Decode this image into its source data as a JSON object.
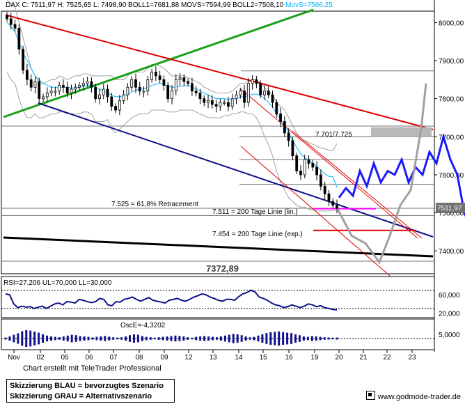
{
  "header": {
    "text": "DAX C: 7511,97 H: 7525,65 L: 7498,90 BOLL1=7681,88 MOVS=7594,99 BOLL2=7508,10",
    "movs_label": "MovS=7566,25"
  },
  "footer": {
    "credit": "Chart erstellt mit TeleTrader Professional",
    "legend_blue": "Skizzierung BLAU = bevorzugtes Szenario",
    "legend_gray": "Skizzierung GRAU = Alternativszenario",
    "site": "www.godmode-trader.de"
  },
  "colors": {
    "candle": "#000000",
    "bollinger": "#a0a0a0",
    "movs": "#00b4ff",
    "resistance": "#e00000",
    "support_green": "#18a018",
    "support_navy": "#10108a",
    "scenario_blue": "#1a1aff",
    "scenario_gray": "#a0a0a0",
    "ma_line": "#ff00ff",
    "indicator": "#10108a"
  },
  "chart_data": [
    {
      "type": "candlestick",
      "title": "DAX",
      "x_ticks": [
        "Nov",
        "02",
        "05",
        "06",
        "07",
        "08",
        "09",
        "12",
        "13",
        "14",
        "15",
        "16",
        "19",
        "20",
        "21",
        "22",
        "23"
      ],
      "y_ticks": [
        8000,
        7900,
        7800,
        7700,
        7600,
        7500,
        7400
      ],
      "y_unit": "pt",
      "ylim": [
        7340,
        8030
      ],
      "current_price_label": "7511,97",
      "close_series": [
        8010,
        7995,
        7985,
        7930,
        7875,
        7850,
        7830,
        7845,
        7800,
        7805,
        7815,
        7820,
        7820,
        7835,
        7830,
        7815,
        7825,
        7830,
        7835,
        7840,
        7845,
        7830,
        7800,
        7810,
        7825,
        7805,
        7780,
        7770,
        7795,
        7810,
        7830,
        7850,
        7830,
        7820,
        7820,
        7850,
        7870,
        7860,
        7850,
        7835,
        7800,
        7820,
        7850,
        7855,
        7845,
        7840,
        7820,
        7815,
        7800,
        7790,
        7795,
        7785,
        7780,
        7790,
        7790,
        7780,
        7800,
        7810,
        7820,
        7790,
        7840,
        7850,
        7840,
        7810,
        7820,
        7810,
        7790,
        7760,
        7740,
        7710,
        7690,
        7650,
        7610,
        7600,
        7640,
        7630,
        7620,
        7600,
        7570,
        7550,
        7530,
        7520,
        7512
      ],
      "boll_upper_series": [
        8060,
        8050,
        8040,
        8000,
        7960,
        7920,
        7880,
        7860,
        7840,
        7840,
        7845,
        7850,
        7850,
        7860,
        7855,
        7850,
        7855,
        7860,
        7860,
        7865,
        7865,
        7860,
        7860,
        7860,
        7860,
        7860,
        7860,
        7850,
        7850,
        7850,
        7860,
        7870,
        7870,
        7870,
        7870,
        7880,
        7890,
        7890,
        7885,
        7880,
        7870,
        7860,
        7860,
        7860,
        7860,
        7855,
        7850,
        7845,
        7840,
        7830,
        7825,
        7820,
        7815,
        7815,
        7815,
        7815,
        7820,
        7830,
        7840,
        7840,
        7845,
        7850,
        7850,
        7840,
        7830,
        7820,
        7810,
        7790,
        7780,
        7770,
        7750,
        7730,
        7710,
        7690,
        7690,
        7685,
        7680,
        7675,
        7670,
        7668,
        7665,
        7663,
        7682
      ],
      "boll_lower_series": [
        7870,
        7850,
        7840,
        7800,
        7770,
        7750,
        7750,
        7760,
        7750,
        7750,
        7755,
        7760,
        7760,
        7765,
        7765,
        7760,
        7760,
        7760,
        7760,
        7765,
        7765,
        7760,
        7740,
        7740,
        7740,
        7745,
        7720,
        7710,
        7720,
        7730,
        7740,
        7750,
        7755,
        7760,
        7760,
        7760,
        7770,
        7770,
        7770,
        7770,
        7765,
        7765,
        7765,
        7770,
        7770,
        7770,
        7770,
        7765,
        7760,
        7755,
        7750,
        7750,
        7750,
        7750,
        7755,
        7755,
        7760,
        7760,
        7765,
        7765,
        7760,
        7760,
        7750,
        7730,
        7700,
        7680,
        7650,
        7610,
        7580,
        7560,
        7540,
        7530,
        7520,
        7515,
        7515,
        7510,
        7508,
        7505,
        7505,
        7505,
        7505,
        7506,
        7508
      ],
      "movs_series": [
        8000,
        7990,
        7975,
        7950,
        7920,
        7900,
        7880,
        7860,
        7850,
        7840,
        7835,
        7830,
        7830,
        7830,
        7830,
        7830,
        7828,
        7828,
        7830,
        7832,
        7835,
        7835,
        7830,
        7825,
        7820,
        7815,
        7810,
        7805,
        7805,
        7808,
        7812,
        7818,
        7822,
        7825,
        7826,
        7830,
        7835,
        7838,
        7840,
        7838,
        7832,
        7830,
        7830,
        7832,
        7834,
        7834,
        7830,
        7826,
        7820,
        7815,
        7810,
        7805,
        7800,
        7800,
        7800,
        7798,
        7798,
        7800,
        7805,
        7805,
        7808,
        7812,
        7812,
        7808,
        7800,
        7790,
        7778,
        7760,
        7745,
        7728,
        7710,
        7690,
        7672,
        7655,
        7645,
        7638,
        7630,
        7622,
        7612,
        7602,
        7596,
        7595,
        7567
      ],
      "annotations": [
        {
          "label": "7.701/7.725",
          "value": 7713
        },
        {
          "label": "7.525 = 61,8% Retracement",
          "value": 7525
        },
        {
          "label": "7.511 = 200 Tage Linie (lin.)",
          "value": 7511
        },
        {
          "label": "7.454 = 200 Tage Linie (exp.)",
          "value": 7454
        },
        {
          "label": "7372,89",
          "value": 7373
        }
      ],
      "blue_scenario": [
        7540,
        7565,
        7545,
        7610,
        7570,
        7630,
        7580,
        7610,
        7600,
        7640,
        7580,
        7620,
        7600,
        7660,
        7630,
        7700,
        7640,
        7600,
        7500,
        7460
      ],
      "gray_scenario": [
        7510,
        7440,
        7420,
        7370,
        7440,
        7520,
        7560,
        7720,
        7840
      ]
    },
    {
      "type": "line",
      "title": "RSI",
      "label_text": "RSI=27,206 UL=70,000 LL=30,000",
      "y_ticks": [
        "60,000",
        "20,000"
      ],
      "ylim": [
        10,
        100
      ],
      "ul": 70,
      "ll": 30,
      "values": [
        62,
        60,
        40,
        32,
        35,
        33,
        34,
        30,
        33,
        35,
        30,
        35,
        40,
        42,
        38,
        45,
        44,
        42,
        50,
        48,
        45,
        43,
        45,
        52,
        50,
        38,
        36,
        45,
        44,
        50,
        52,
        55,
        50,
        46,
        50,
        54,
        48,
        46,
        44,
        42,
        48,
        50,
        52,
        48,
        46,
        50,
        55,
        58,
        62,
        60,
        55,
        52,
        48,
        46,
        50,
        50,
        48,
        56,
        62,
        65,
        70,
        66,
        55,
        52,
        48,
        42,
        38,
        36,
        32,
        34,
        38,
        35,
        32,
        35,
        40,
        38,
        34,
        36,
        32,
        30,
        28,
        27
      ]
    },
    {
      "type": "bar",
      "title": "OscE",
      "label_text": "OscE=-4,3202",
      "y_ticks": [
        "5,0000"
      ],
      "values": [
        5,
        10,
        18,
        25,
        35,
        40,
        38,
        33,
        28,
        20,
        14,
        10,
        8,
        6,
        10,
        14,
        18,
        16,
        12,
        10,
        8,
        5,
        8,
        10,
        12,
        9,
        6,
        4,
        6,
        10,
        16,
        20,
        18,
        12,
        8,
        6,
        4,
        6,
        8,
        10,
        12,
        14,
        12,
        10,
        6,
        4,
        8,
        10,
        12,
        10,
        8,
        6,
        10,
        14,
        18,
        22,
        20,
        16,
        10,
        6,
        8,
        14,
        20,
        26,
        30,
        32,
        34,
        30,
        28,
        26,
        20,
        16,
        10,
        8,
        12,
        10,
        8,
        6,
        5,
        4,
        5
      ]
    }
  ]
}
